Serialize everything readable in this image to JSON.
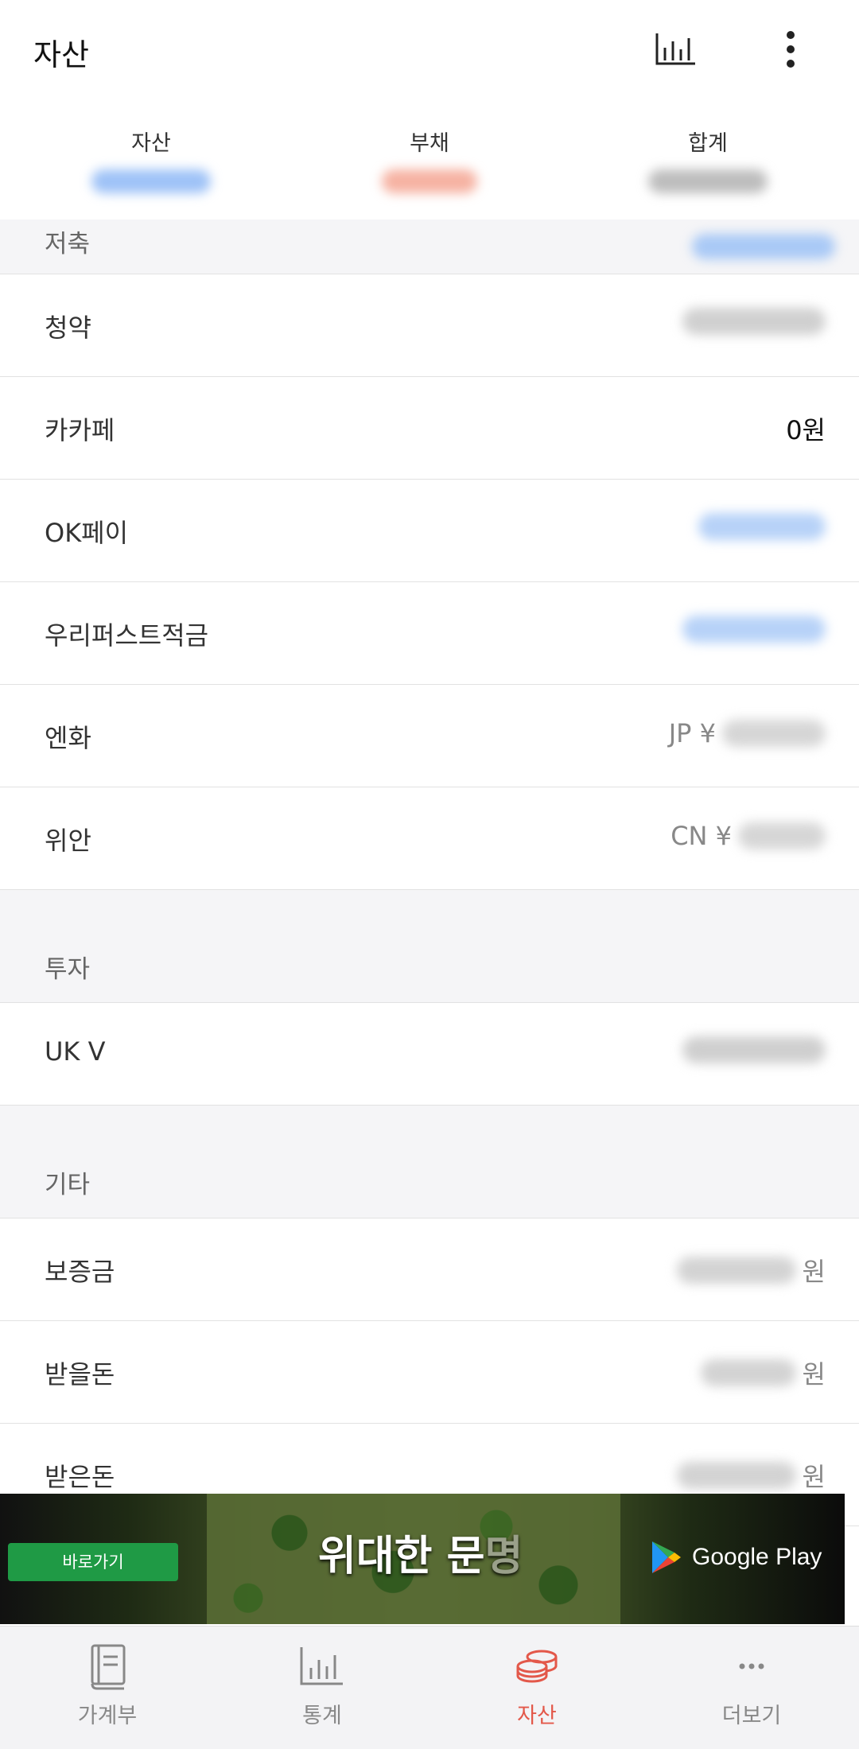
{
  "header": {
    "title": "자산",
    "chart_icon": "bar-chart-icon",
    "more_icon": "more-vertical-icon"
  },
  "summary": {
    "assets_label": "자산",
    "assets_color": "#3b82f6",
    "liabilities_label": "부채",
    "liabilities_color": "#ef6a4f",
    "total_label": "합계",
    "total_color": "#555555"
  },
  "sections": {
    "savings": {
      "label": "저축"
    },
    "investment": {
      "label": "투자"
    },
    "other": {
      "label": "기타"
    }
  },
  "rows": {
    "subscription": {
      "name": "청약"
    },
    "kakaopay": {
      "name": "카카페",
      "value": "0원"
    },
    "okpay": {
      "name": "OK페이"
    },
    "woori": {
      "name": "우리퍼스트적금"
    },
    "yen": {
      "name": "엔화",
      "prefix": "JP ¥"
    },
    "yuan": {
      "name": "위안",
      "prefix": "CN ¥"
    },
    "ukv": {
      "name": "UK V"
    },
    "deposit": {
      "name": "보증금",
      "suffix": "원"
    },
    "receivable": {
      "name": "받을돈",
      "suffix": "원"
    },
    "received": {
      "name": "받은돈",
      "suffix": "원"
    }
  },
  "ad": {
    "button": "바로가기",
    "headline_a": "위대한 문",
    "headline_b": "명",
    "store": "Google Play"
  },
  "nav": {
    "ledger": "가계부",
    "stats": "통계",
    "assets": "자산",
    "more": "더보기",
    "active_color": "#e3584a"
  }
}
